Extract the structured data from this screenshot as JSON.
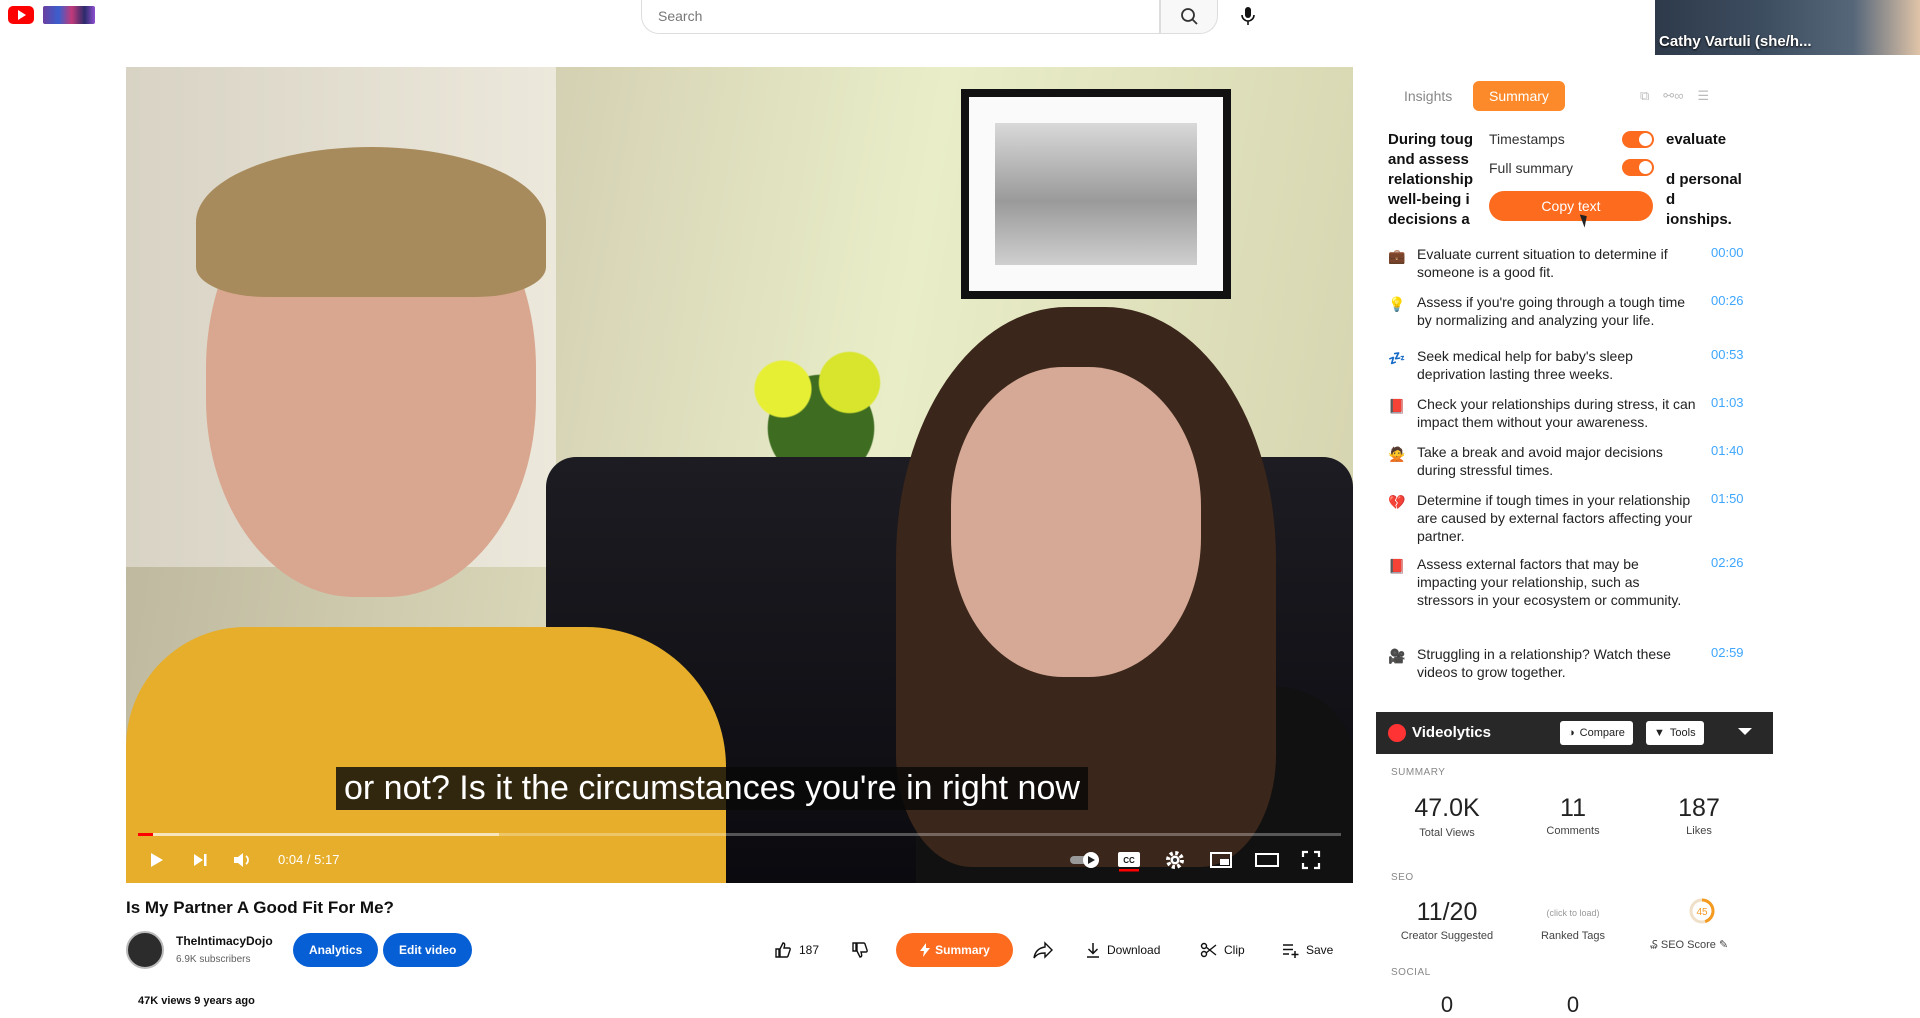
{
  "topbar": {
    "search_placeholder": "Search",
    "webcam_name": "Cathy Vartuli (she/h..."
  },
  "player": {
    "caption": "or not? Is it the circumstances you're in right now",
    "time": "0:04 / 5:17",
    "progress_played": 0.0125,
    "progress_buffered": 0.3
  },
  "video": {
    "title": "Is My Partner A Good Fit For Me?",
    "channel_name": "TheIntimacyDojo",
    "subscribers": "6.9K subscribers",
    "analytics_label": "Analytics",
    "edit_label": "Edit video",
    "likes": "187",
    "summary_label": "Summary",
    "download_label": "Download",
    "clip_label": "Clip",
    "save_label": "Save",
    "views_line": "47K views  9 years ago"
  },
  "panel": {
    "tab_insights": "Insights",
    "tab_summary": "Summary",
    "lead_left": [
      "During toug",
      "and assess",
      "relationship",
      "well-being i",
      "decisions a"
    ],
    "lead_right": [
      "evaluate",
      "",
      "d personal",
      "d",
      "ionships."
    ],
    "dropdown": {
      "timestamps_label": "Timestamps",
      "full_summary_label": "Full summary",
      "copy_label": "Copy text"
    },
    "items": [
      {
        "icon": "💼",
        "text": "Evaluate current situation to determine if someone is a good fit.",
        "ts": "00:00"
      },
      {
        "icon": "💡",
        "text": "Assess if you're going through a tough time by normalizing and analyzing your life.",
        "ts": "00:26"
      },
      {
        "icon": "💤",
        "text": "Seek medical help for baby's sleep deprivation lasting three weeks.",
        "ts": "00:53"
      },
      {
        "icon": "📕",
        "text": "Check your relationships during stress, it can impact them without your awareness.",
        "ts": "01:03"
      },
      {
        "icon": "🙅",
        "text": "Take a break and avoid major decisions during stressful times.",
        "ts": "01:40"
      },
      {
        "icon": "💔",
        "text": "Determine if tough times in your relationship are caused by external factors affecting your partner.",
        "ts": "01:50"
      },
      {
        "icon": "📕",
        "text": "Assess external factors that may be impacting your relationship, such as stressors in your ecosystem or community.",
        "ts": "02:26"
      },
      {
        "icon": "🎥",
        "text": "Struggling in a relationship? Watch these videos to grow together.",
        "ts": "02:59"
      }
    ]
  },
  "videolytics": {
    "name": "Videolytics",
    "compare_label": "Compare",
    "tools_label": "Tools",
    "summary_header": "SUMMARY",
    "total_views": "47.0K",
    "total_views_label": "Total Views",
    "comments": "11",
    "comments_label": "Comments",
    "likes": "187",
    "likes_label": "Likes",
    "seo_header": "SEO",
    "creator_suggested": "11/20",
    "creator_suggested_label": "Creator Suggested",
    "ranked_tags_hint": "(click to load)",
    "ranked_tags_label": "Ranked Tags",
    "seo_score": "45",
    "seo_score_label": "SEO Score",
    "social_header": "SOCIAL",
    "social_a": "0",
    "social_b": "0"
  }
}
